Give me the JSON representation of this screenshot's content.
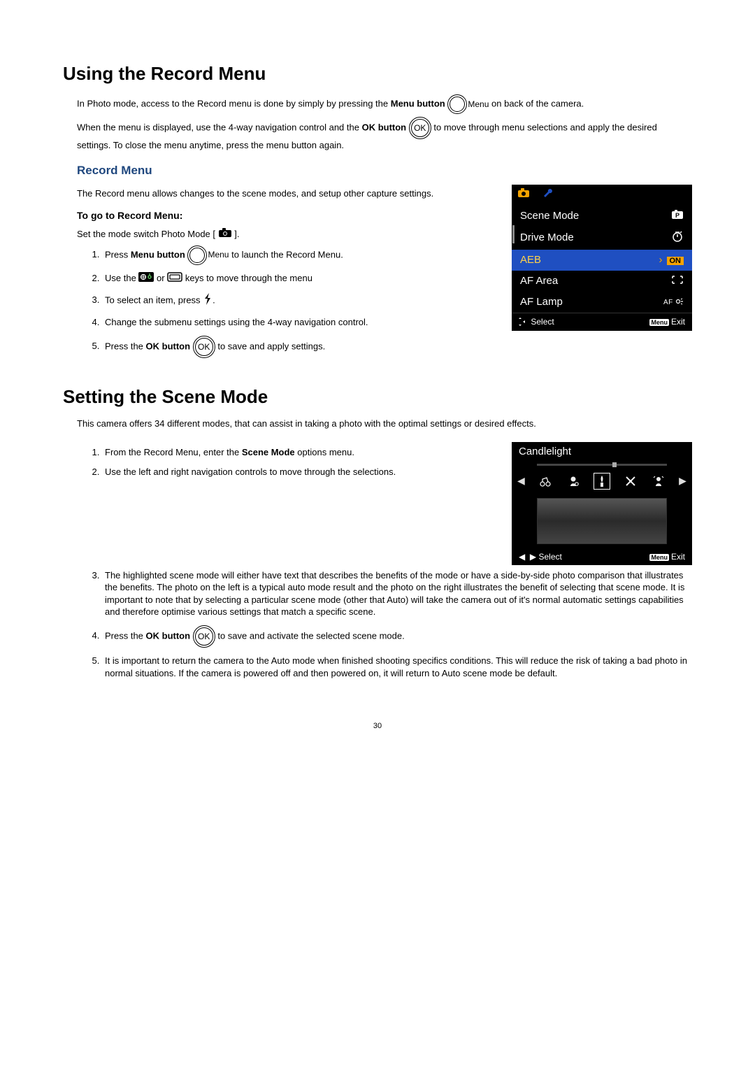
{
  "page_number": "30",
  "section1": {
    "title": "Using the Record Menu",
    "p1_a": "In Photo mode, access to the Record menu is done by simply by pressing the ",
    "p1_b": "Menu button",
    "p1_menu_label": "Menu",
    "p1_c": " on back of the camera.",
    "p2_a": "When the menu is displayed, use the 4-way navigation control and the ",
    "p2_b": "OK button",
    "p2_c": " to move through menu selections and apply the desired settings. To close the menu anytime, press the menu button again.",
    "ok_label": "OK",
    "h2": "Record Menu",
    "p3": "The Record menu allows changes to the scene modes, and setup other capture settings.",
    "h3": "To go to Record Menu:",
    "p4_a": "Set the mode switch Photo Mode [ ",
    "p4_b": " ].",
    "ol": {
      "i1_a": "Press ",
      "i1_b": "Menu button",
      "i1_menu_label": "Menu",
      "i1_c": " to launch the Record Menu.",
      "i2_a": "Use the ",
      "i2_b": " or ",
      "i2_c": " keys to move through the menu",
      "i3_a": "To select an item, press ",
      "i3_b": ".",
      "i4": "Change the submenu settings using the 4-way navigation control.",
      "i5_a": "Press the ",
      "i5_b": "OK button",
      "i5_c": " to save and apply settings."
    },
    "menu_shot": {
      "rows": [
        {
          "label": "Scene Mode"
        },
        {
          "label": "Drive Mode"
        },
        {
          "label": "AEB",
          "value": "ON",
          "selected": true
        },
        {
          "label": "AF Area"
        },
        {
          "label": "AF Lamp"
        }
      ],
      "footer_select": "Select",
      "footer_menu_tag": "Menu",
      "footer_exit": "Exit"
    }
  },
  "section2": {
    "title": "Setting the Scene Mode",
    "p1": "This camera offers 34 different modes, that can assist in taking a photo with the optimal settings or desired effects.",
    "ol": {
      "i1_a": "From the Record Menu, enter the ",
      "i1_b": "Scene Mode",
      "i1_c": " options menu.",
      "i2": "Use the left and right navigation controls to move through the selections.",
      "i3": "The highlighted scene mode will either have text that describes the benefits of the mode or have a side-by-side photo comparison that illustrates the benefits. The photo on the left is a typical auto mode result and the photo on the right illustrates the benefit of selecting that scene mode. It is important to note that by selecting a particular scene mode (other that Auto) will take the camera out of it's normal automatic settings capabilities and therefore optimise various settings that match a specific scene.",
      "i4_a": "Press the ",
      "i4_b": "OK button",
      "i4_c": " to save and activate the selected scene mode.",
      "i5": "It is important to return the camera to the Auto mode when finished shooting specifics conditions. This will reduce the risk of taking a bad photo in normal situations. If the camera is powered off and then powered on, it will return to Auto scene mode be default."
    },
    "scene_shot": {
      "title": "Candlelight",
      "footer_select": "Select",
      "footer_menu_tag": "Menu",
      "footer_exit": "Exit"
    }
  }
}
